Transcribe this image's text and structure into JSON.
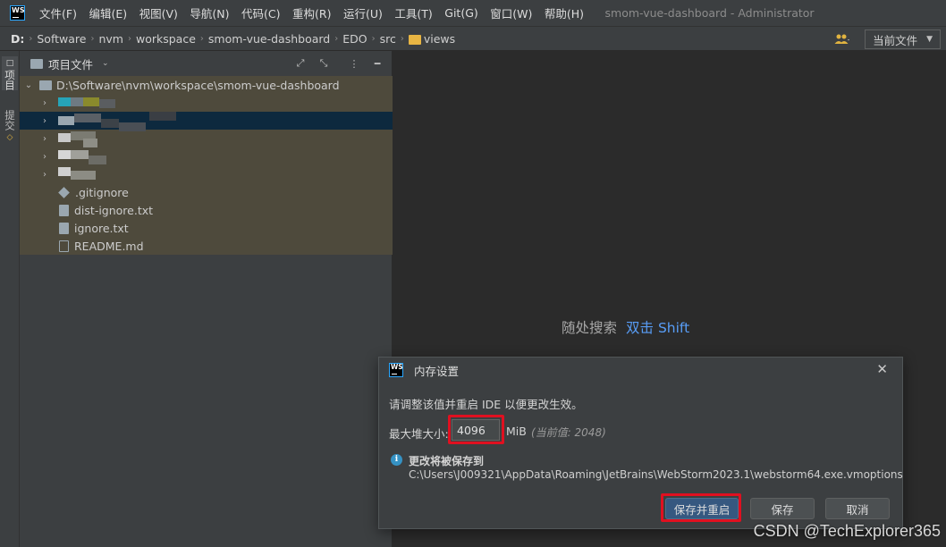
{
  "app": {
    "window_title": "smom-vue-dashboard - Administrator",
    "logo_text": "WS",
    "menu": [
      "文件(F)",
      "编辑(E)",
      "视图(V)",
      "导航(N)",
      "代码(C)",
      "重构(R)",
      "运行(U)",
      "工具(T)",
      "Git(G)",
      "窗口(W)",
      "帮助(H)"
    ]
  },
  "breadcrumb": [
    "D:",
    "Software",
    "nvm",
    "workspace",
    "smom-vue-dashboard",
    "EDO",
    "src",
    "views"
  ],
  "navbar": {
    "users_icon": "users-icon",
    "scope_label": "当前文件"
  },
  "toolstrip": {
    "project_label": "项目",
    "commit_label": "提交"
  },
  "project_panel": {
    "title": "项目文件",
    "root": "D:\\Software\\nvm\\workspace\\smom-vue-dashboard",
    "files": [
      ".gitignore",
      "dist-ignore.txt",
      "ignore.txt",
      "README.md"
    ]
  },
  "editor": {
    "hint_label": "随处搜索",
    "hint_key": "双击 Shift"
  },
  "dialog": {
    "title": "内存设置",
    "message": "请调整该值并重启 IDE 以便更改生效。",
    "heap_label": "最大堆大小:",
    "heap_value": "4096",
    "unit": "MiB",
    "current_value": "(当前值: 2048)",
    "save_heading": "更改将被保存到",
    "save_path": "C:\\Users\\J009321\\AppData\\Roaming\\JetBrains\\WebStorm2023.1\\webstorm64.exe.vmoptions",
    "buttons": {
      "save_restart": "保存并重启",
      "save": "保存",
      "cancel": "取消"
    }
  },
  "watermark": "CSDN @TechExplorer365",
  "colors": {
    "accent_blue": "#589df6",
    "highlight_red": "#e01020",
    "primary_button": "#365880",
    "folder_yellow": "#e8b543"
  }
}
